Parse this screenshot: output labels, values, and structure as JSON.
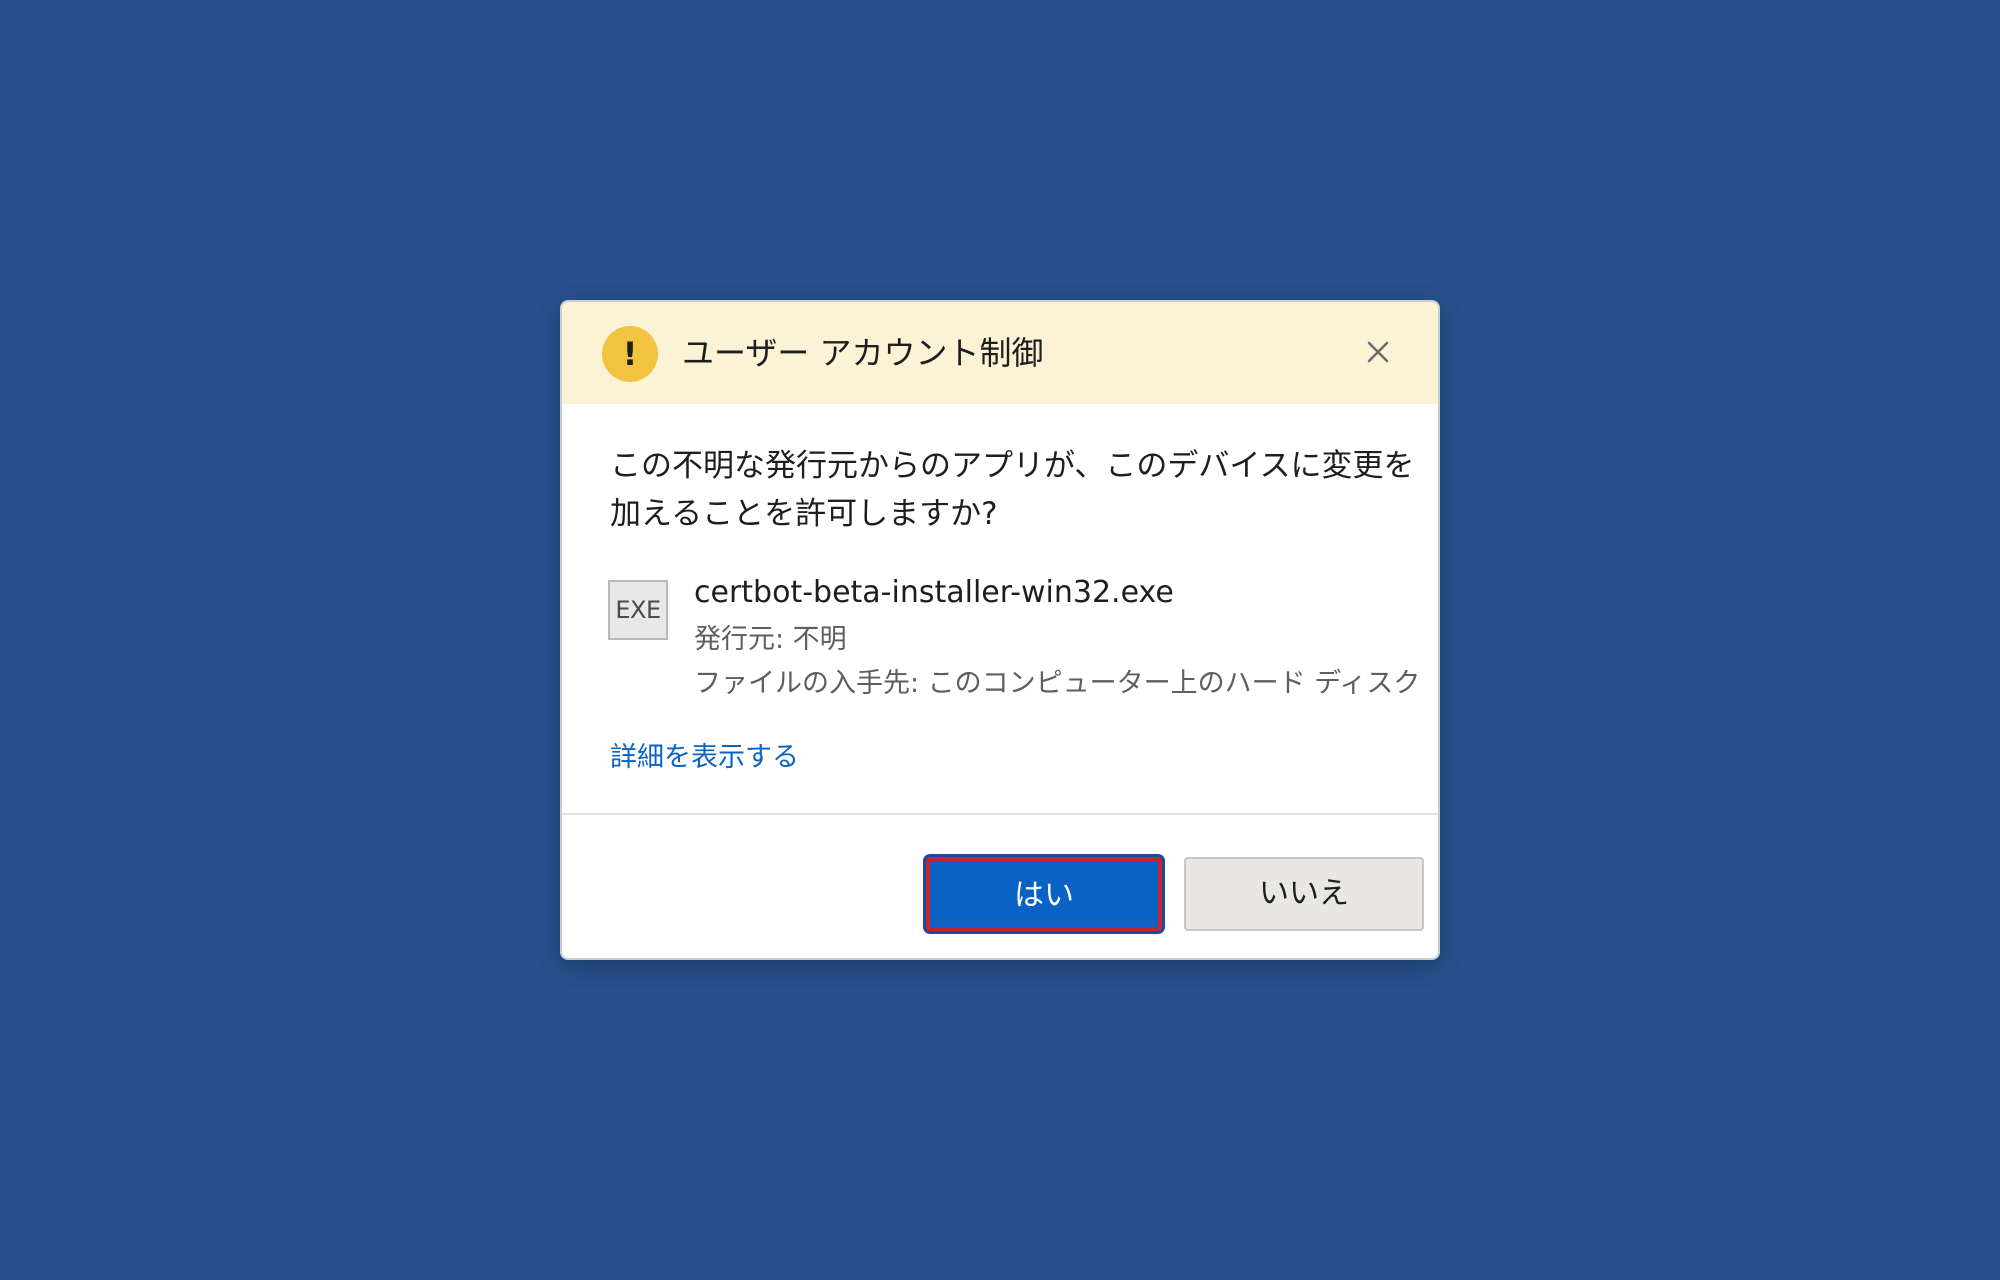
{
  "dialog": {
    "title": "ユーザー アカウント制御",
    "warning_icon_glyph": "!",
    "question_line1": "この不明な発行元からのアプリが、このデバイスに変更を",
    "question_line2": "加えることを許可しますか?",
    "file_icon_label": "EXE",
    "file_name": "certbot-beta-installer-win32.exe",
    "publisher": "発行元: 不明",
    "origin": "ファイルの入手先: このコンピューター上のハード ディスク",
    "details_link": "詳細を表示する",
    "yes_label": "はい",
    "no_label": "いいえ"
  },
  "colors": {
    "background": "#27508c",
    "header": "#fcf2d6",
    "warning_icon": "#f1c33e",
    "primary_button": "#0a63c4",
    "highlight_border": "#c8252b",
    "link": "#0a65c2"
  },
  "icons": {
    "warning": "warning-icon",
    "close": "close-icon",
    "file": "exe-file-icon"
  }
}
